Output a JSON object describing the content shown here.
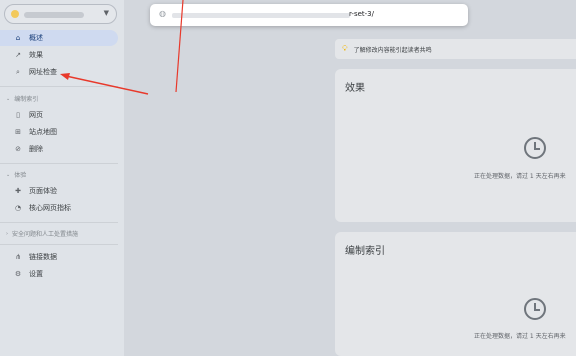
{
  "browser": {
    "url_suffix": "r-set-3/"
  },
  "sidebar": {
    "items": [
      {
        "label": "概述",
        "icon": "home-icon",
        "glyph": "⌂",
        "active": true
      },
      {
        "label": "效果",
        "icon": "trending-icon",
        "glyph": "↗",
        "active": false
      },
      {
        "label": "网址检查",
        "icon": "search-icon",
        "glyph": "⌕",
        "active": false
      }
    ],
    "sections": [
      {
        "label": "编制索引",
        "items": [
          {
            "label": "网页",
            "icon": "page-icon",
            "glyph": "▯"
          },
          {
            "label": "站点地图",
            "icon": "sitemap-icon",
            "glyph": "⊞"
          },
          {
            "label": "删除",
            "icon": "removal-icon",
            "glyph": "⊘"
          }
        ]
      },
      {
        "label": "体验",
        "items": [
          {
            "label": "页面体验",
            "icon": "page-experience-icon",
            "glyph": "✚"
          },
          {
            "label": "核心网页指标",
            "icon": "speedometer-icon",
            "glyph": "◔"
          }
        ]
      },
      {
        "label": "安全问题和人工处置措施",
        "items": []
      }
    ],
    "bottom_items": [
      {
        "label": "链接数据",
        "icon": "links-icon",
        "glyph": "⋔"
      },
      {
        "label": "设置",
        "icon": "settings-icon",
        "glyph": "⚙"
      }
    ]
  },
  "banner": {
    "text": "了解修改内容能引起读者共鸣"
  },
  "cards": [
    {
      "title": "效果",
      "status": "正在处理数据，请过 1 天左右再来"
    },
    {
      "title": "编制索引",
      "status": "正在处理数据，请过 1 天左右再来"
    }
  ],
  "colors": {
    "active_nav": "#cfdaf0",
    "annotation_arrow": "#e8392b",
    "bulb": "#f2b600"
  }
}
